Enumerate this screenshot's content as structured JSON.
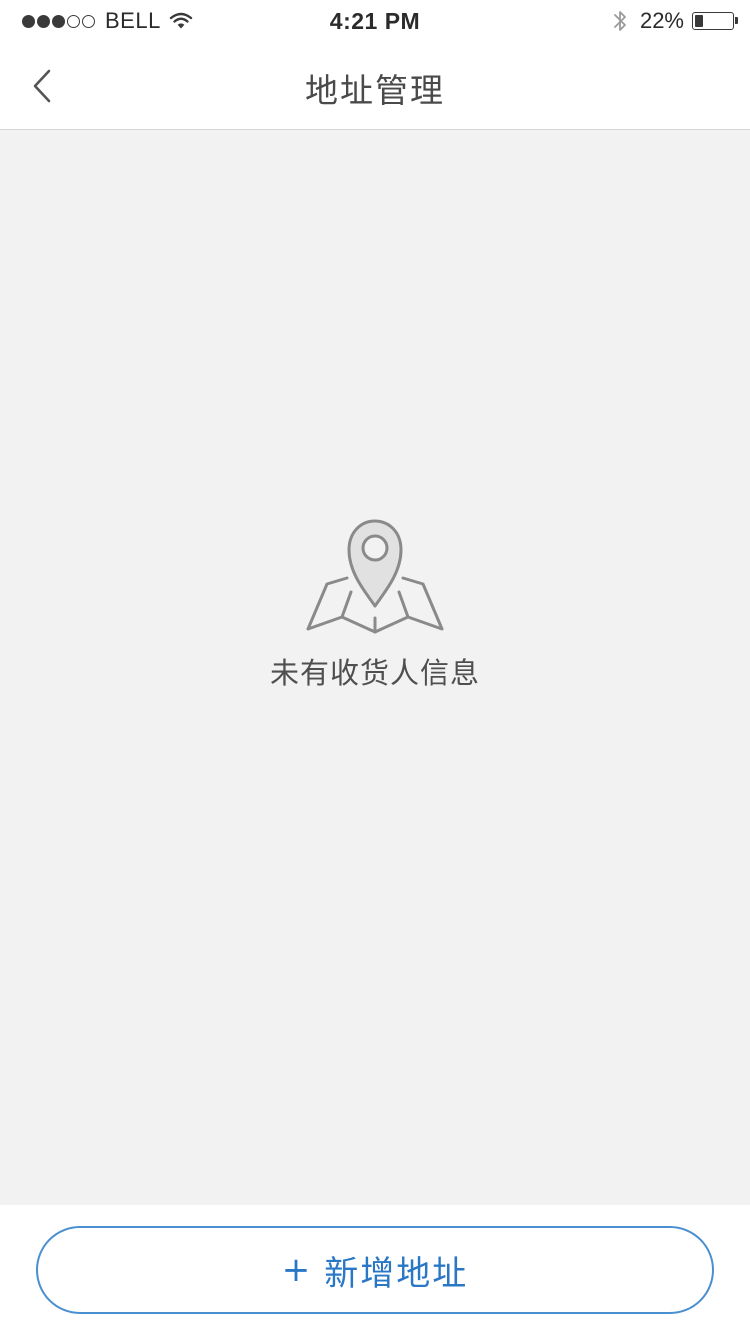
{
  "status_bar": {
    "carrier": "BELL",
    "time": "4:21 PM",
    "battery_percent": "22%",
    "battery_level": 0.22,
    "signal_bars_filled": 3,
    "signal_bars_total": 5
  },
  "nav": {
    "title": "地址管理",
    "back_icon": "chevron-left-icon"
  },
  "empty_state": {
    "icon": "map-pin-icon",
    "message": "未有收货人信息"
  },
  "footer": {
    "plus": "+",
    "add_label": "新增地址"
  },
  "colors": {
    "accent": "#2a78c5",
    "background": "#f2f2f2",
    "icon_gray": "#8a8a8a"
  }
}
